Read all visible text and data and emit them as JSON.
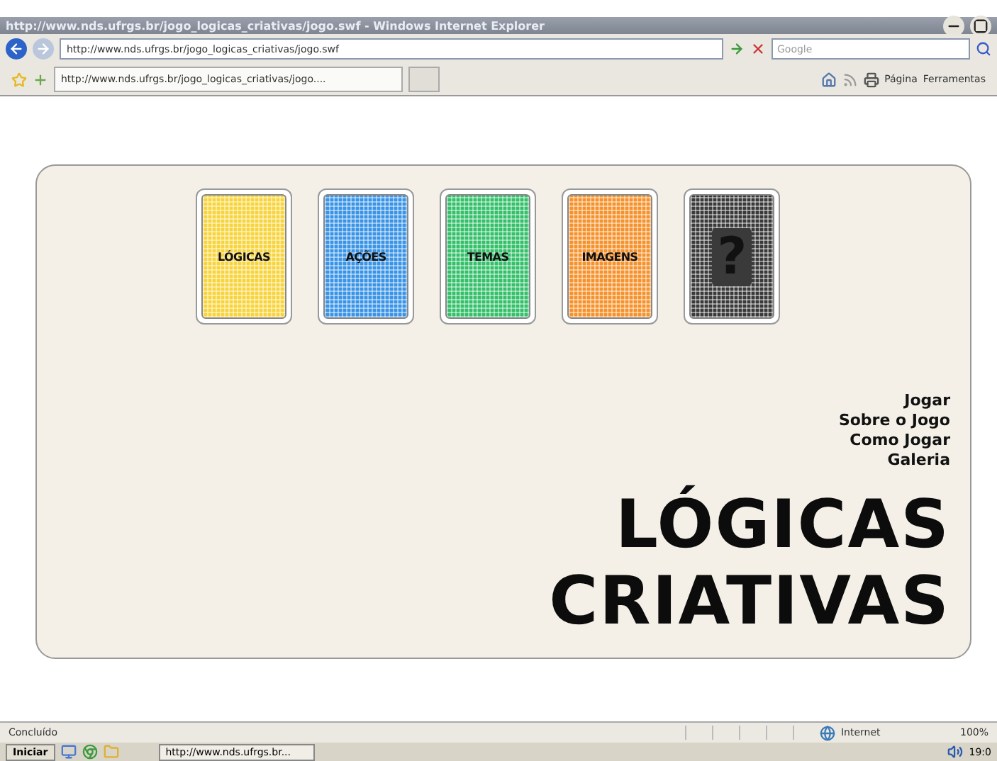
{
  "window": {
    "title": "http://www.nds.ufrgs.br/jogo_logicas_criativas/jogo.swf - Windows Internet Explorer"
  },
  "address_bar": {
    "url": "http://www.nds.ufrgs.br/jogo_logicas_criativas/jogo.swf",
    "search_placeholder": "Google"
  },
  "tab": {
    "label": "http://www.nds.ufrgs.br/jogo_logicas_criativas/jogo...."
  },
  "command_bar": [
    "Página",
    "Ferramentas"
  ],
  "cards": [
    {
      "label": "LÓGICAS",
      "color": "#f7d43c"
    },
    {
      "label": "AÇÕES",
      "color": "#3a94e6"
    },
    {
      "label": "TEMAS",
      "color": "#34c06a"
    },
    {
      "label": "IMAGENS",
      "color": "#f5922c"
    },
    {
      "label": "?",
      "color": "#3a3a3a"
    }
  ],
  "menu": [
    "Jogar",
    "Sobre o Jogo",
    "Como Jogar",
    "Galeria"
  ],
  "title_lines": [
    "LÓGICAS",
    "CRIATIVAS"
  ],
  "status_bar": {
    "text": "Concluído",
    "zone": "Internet",
    "zoom": "100%"
  },
  "taskbar": {
    "start": "Iniciar",
    "task": "http://www.nds.ufrgs.br...",
    "clock": "19:0"
  }
}
